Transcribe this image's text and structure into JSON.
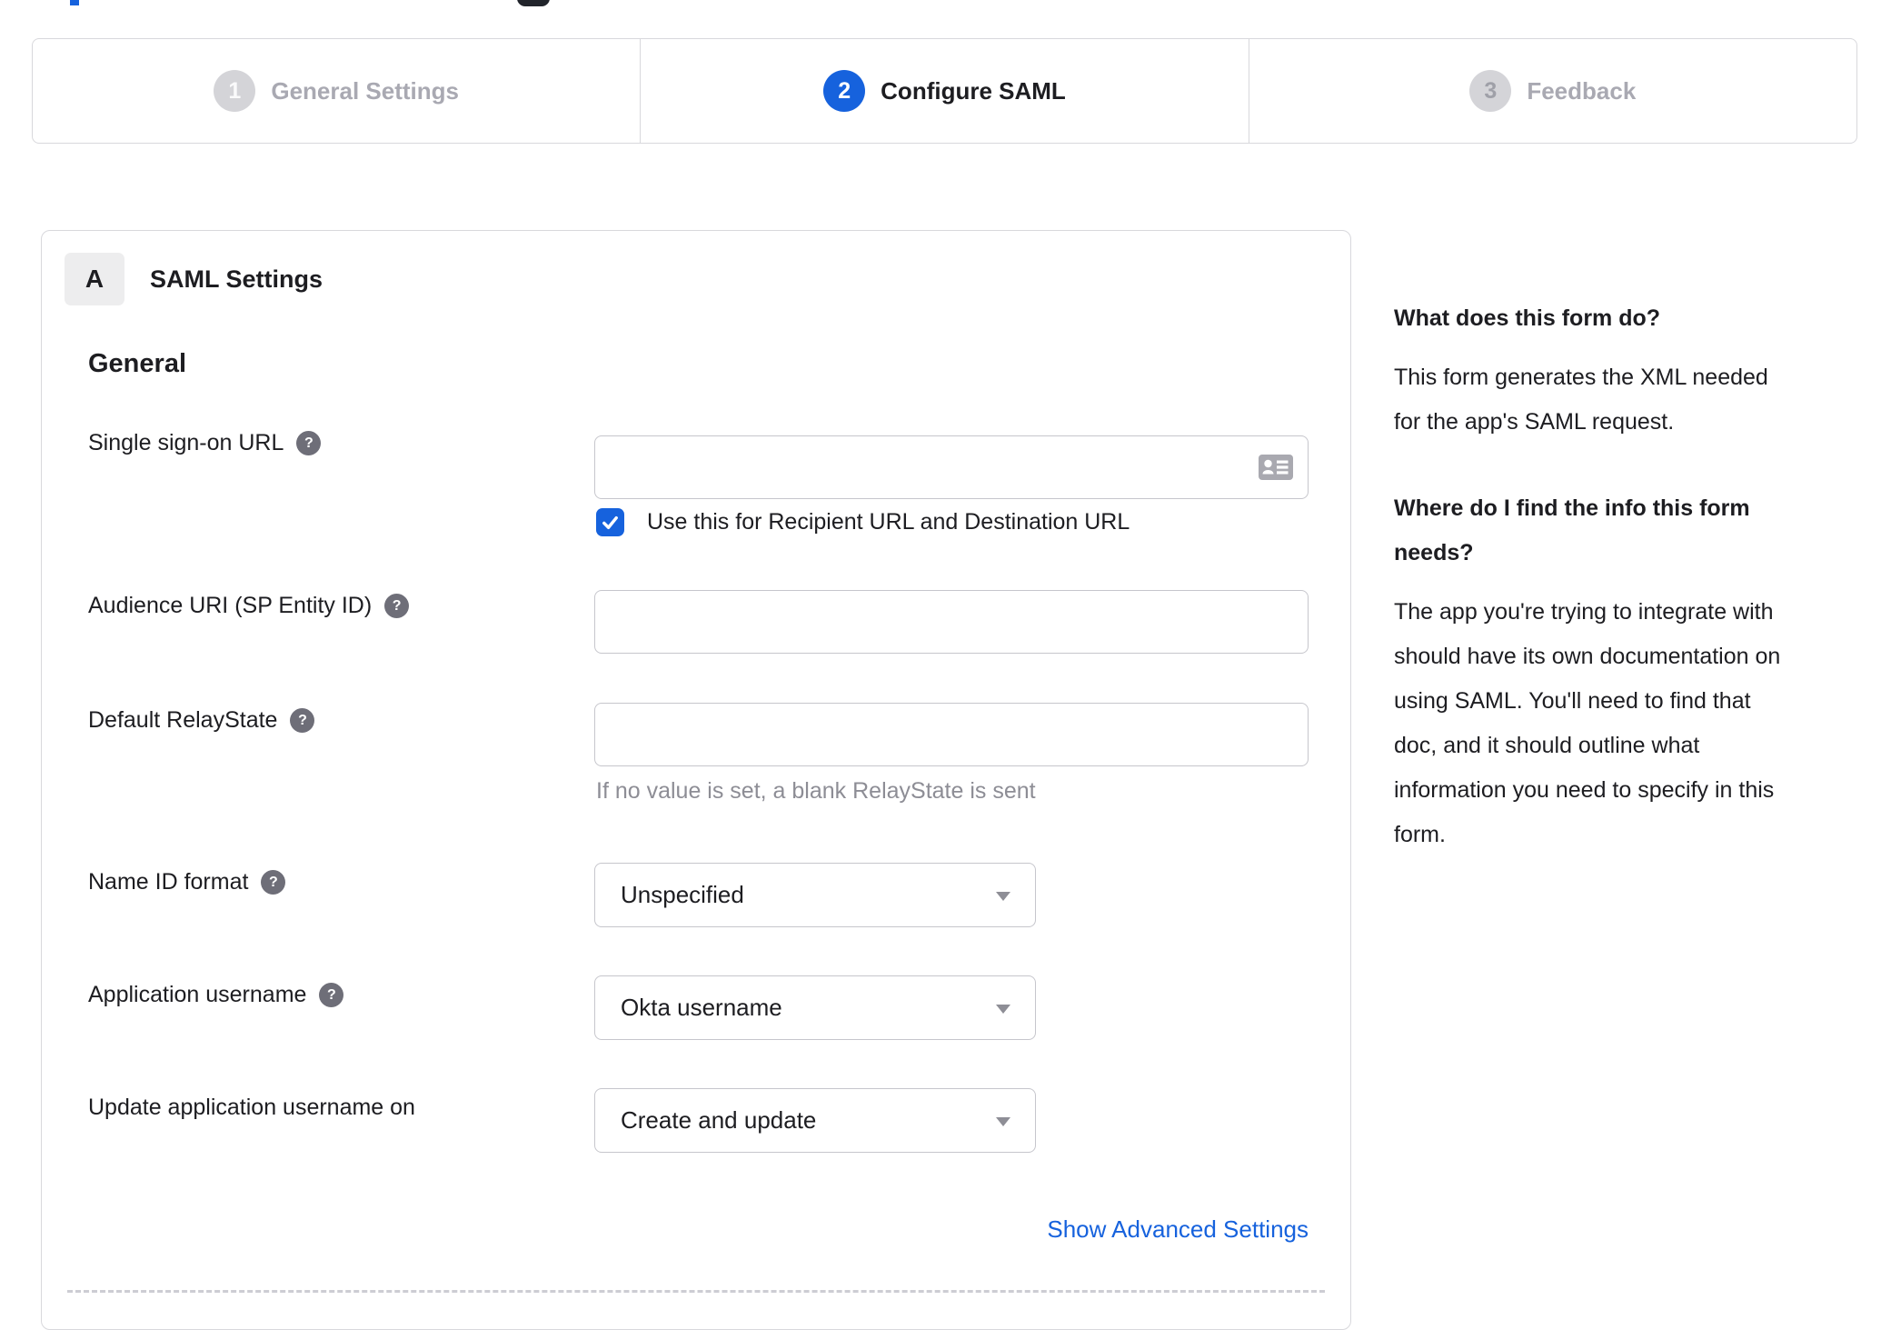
{
  "colors": {
    "accent_blue": "#1662dd",
    "border_gray": "#d8d8dc",
    "input_border": "#c6c6cc",
    "inactive_text": "#a9a9b2",
    "hint_text": "#8d8d95",
    "dark_text": "#1d1d21",
    "help_icon_bg": "#6e6e78"
  },
  "stepper": {
    "steps": [
      {
        "number": "1",
        "label": "General Settings",
        "state": "done"
      },
      {
        "number": "2",
        "label": "Configure SAML",
        "state": "active"
      },
      {
        "number": "3",
        "label": "Feedback",
        "state": "next"
      }
    ]
  },
  "panel": {
    "badge": "A",
    "title": "SAML Settings",
    "section_heading": "General",
    "fields": {
      "sso": {
        "label": "Single sign-on URL",
        "value": "",
        "checkbox_label": "Use this for Recipient URL and Destination URL",
        "checkbox_checked": true
      },
      "audience": {
        "label": "Audience URI (SP Entity ID)",
        "value": ""
      },
      "relay": {
        "label": "Default RelayState",
        "value": "",
        "hint": "If no value is set, a blank RelayState is sent"
      },
      "nameid": {
        "label": "Name ID format",
        "value": "Unspecified"
      },
      "appuser": {
        "label": "Application username",
        "value": "Okta username"
      },
      "updateuser": {
        "label": "Update application username on",
        "value": "Create and update"
      }
    },
    "advanced_link": "Show Advanced Settings"
  },
  "sidebar": {
    "heading1": "What does this form do?",
    "paragraph1": [
      "This form generates the XML needed",
      "for the app's SAML request."
    ],
    "heading2": [
      "Where do I find the info this form",
      "needs?"
    ],
    "paragraph2": [
      "The app you're trying to integrate with",
      "should have its own documentation on",
      "using SAML. You'll need to find that",
      "doc, and it should outline what",
      "information you need to specify in this",
      "form."
    ]
  }
}
